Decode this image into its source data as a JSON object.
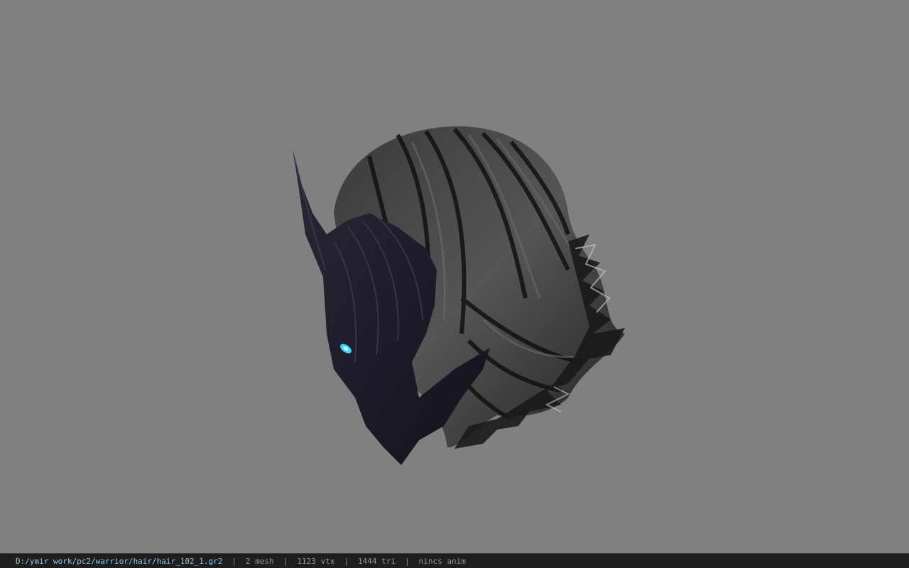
{
  "viewer": {
    "background_color": "#808080",
    "model_preview": {
      "subject": "dark armored helmet with long black hair",
      "eye_glow_color": "#3ad6ff"
    }
  },
  "status_bar": {
    "file_path": "D:/ymir work/pc2/warrior/hair/hair_102_1.gr2",
    "mesh_count": "2 mesh",
    "vertex_count": "1123 vtx",
    "triangle_count": "1444 tri",
    "animation": "nincs anim",
    "separator": "|"
  }
}
